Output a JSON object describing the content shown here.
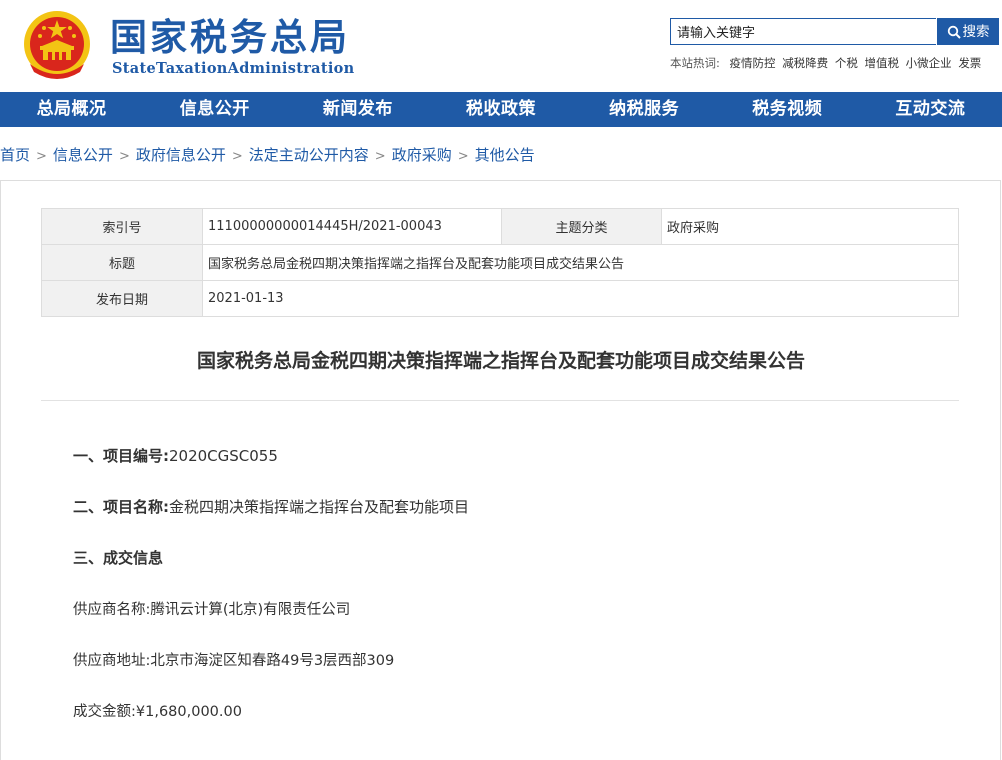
{
  "header": {
    "title": "国家税务总局",
    "subtitle": "StateTaxationAdministration",
    "search": {
      "placeholder": "请输入关键字",
      "button_label": "搜索"
    },
    "hot_words": {
      "label": "本站热词:",
      "items": [
        "疫情防控",
        "减税降费",
        "个税",
        "增值税",
        "小微企业",
        "发票"
      ]
    }
  },
  "nav": [
    "总局概况",
    "信息公开",
    "新闻发布",
    "税收政策",
    "纳税服务",
    "税务视频",
    "互动交流"
  ],
  "breadcrumb": [
    "首页",
    "信息公开",
    "政府信息公开",
    "法定主动公开内容",
    "政府采购",
    "其他公告"
  ],
  "meta_table": {
    "index_label": "索引号",
    "index_value": "11100000000014445H/2021-00043",
    "topic_label": "主题分类",
    "topic_value": "政府采购",
    "title_label": "标题",
    "title_value": "国家税务总局金税四期决策指挥端之指挥台及配套功能项目成交结果公告",
    "date_label": "发布日期",
    "date_value": "2021-01-13"
  },
  "article": {
    "title": "国家税务总局金税四期决策指挥端之指挥台及配套功能项目成交结果公告",
    "s1_label": "一、项目编号:",
    "s1_value": "2020CGSC055",
    "s2_label": "二、项目名称:",
    "s2_value": "金税四期决策指挥端之指挥台及配套功能项目",
    "s3_label": "三、成交信息",
    "supplier_name": "供应商名称:腾讯云计算(北京)有限责任公司",
    "supplier_address": "供应商地址:北京市海淀区知春路49号3层西部309",
    "amount": "成交金额:¥1,680,000.00"
  },
  "colors": {
    "brand_blue": "#1f5aa6",
    "emblem_red": "#d9261c",
    "emblem_gold": "#f3c414"
  }
}
